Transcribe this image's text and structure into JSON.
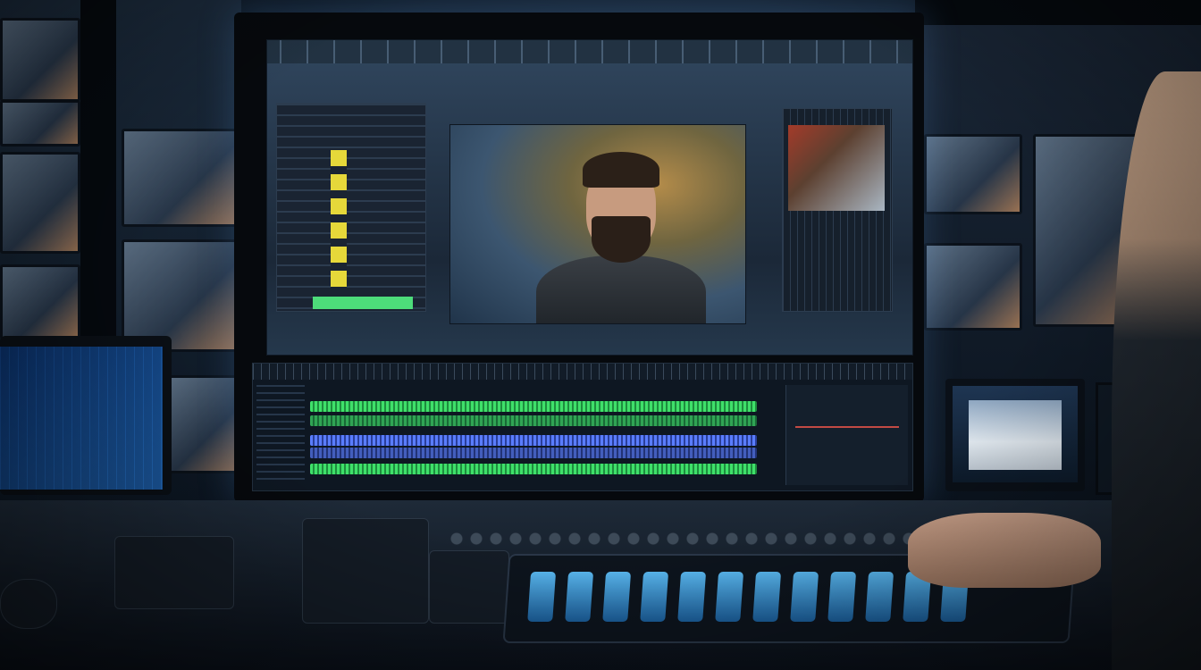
{
  "scene": {
    "main_colors": {
      "background": "#0b1420",
      "accent_blue": "#5a7dff",
      "accent_green": "#3fe06a",
      "highlight_yellow": "#e6d83a",
      "fader_blue": "#5ab8f0"
    }
  }
}
